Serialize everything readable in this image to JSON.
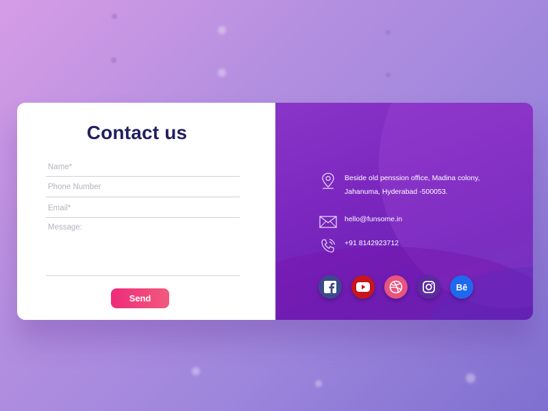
{
  "form": {
    "title": "Contact us",
    "name_placeholder": "Name*",
    "phone_placeholder": "Phone Number",
    "email_placeholder": "Email*",
    "message_placeholder": "Message:",
    "send_label": "Send"
  },
  "contact": {
    "address_line1": "Beside old penssion office, Madina colony,",
    "address_line2": "Jahanuma, Hyderabad -500053.",
    "email": "hello@funsome.in",
    "phone": "+91 8142923712"
  },
  "socials": {
    "behance_text": "Bē",
    "icons": [
      "facebook-icon",
      "youtube-icon",
      "dribbble-icon",
      "instagram-icon",
      "behance-icon"
    ]
  },
  "colors": {
    "title": "#22205f",
    "send_start": "#ee2a7b",
    "send_end": "#f25a7d",
    "panel_start": "#8a35c8",
    "panel_end": "#5f2bb6"
  }
}
